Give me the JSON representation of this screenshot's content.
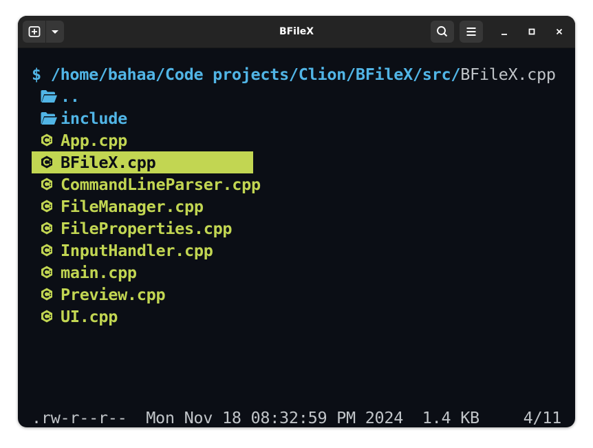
{
  "window": {
    "title": "BFileX"
  },
  "titlebar": {
    "new_tab_icon": "new-tab-icon",
    "dropdown_icon": "chevron-down-icon",
    "search_icon": "search-icon",
    "menu_icon": "hamburger-menu-icon",
    "minimize_icon": "minimize-icon",
    "maximize_icon": "maximize-icon",
    "close_icon": "close-icon"
  },
  "terminal": {
    "prompt": {
      "symbol": "$",
      "path": "/home/bahaa/Code projects/Clion/BFileX/src/",
      "file": "BFileX.cpp"
    },
    "entries": [
      {
        "name": "..",
        "type": "dir",
        "icon": "folder-open-icon"
      },
      {
        "name": "include",
        "type": "dir",
        "icon": "folder-open-icon"
      },
      {
        "name": "App.cpp",
        "type": "cpp",
        "icon": "cpp-file-icon"
      },
      {
        "name": "BFileX.cpp",
        "type": "cpp",
        "icon": "cpp-file-icon",
        "selected": true
      },
      {
        "name": "CommandLineParser.cpp",
        "type": "cpp",
        "icon": "cpp-file-icon"
      },
      {
        "name": "FileManager.cpp",
        "type": "cpp",
        "icon": "cpp-file-icon"
      },
      {
        "name": "FileProperties.cpp",
        "type": "cpp",
        "icon": "cpp-file-icon"
      },
      {
        "name": "InputHandler.cpp",
        "type": "cpp",
        "icon": "cpp-file-icon"
      },
      {
        "name": "main.cpp",
        "type": "cpp",
        "icon": "cpp-file-icon"
      },
      {
        "name": "Preview.cpp",
        "type": "cpp",
        "icon": "cpp-file-icon"
      },
      {
        "name": "UI.cpp",
        "type": "cpp",
        "icon": "cpp-file-icon"
      }
    ],
    "status": {
      "permissions": ".rw-r--r--",
      "modified": "Mon Nov 18 08:32:59 PM 2024",
      "size": "1.4 KB",
      "position": "4/11"
    }
  },
  "colors": {
    "terminal_bg": "#0b0e15",
    "titlebar_bg": "#242424",
    "dir": "#51b5e6",
    "cpp": "#c2d652",
    "selection": "#c2d652",
    "status_text": "#c0c4c8"
  }
}
